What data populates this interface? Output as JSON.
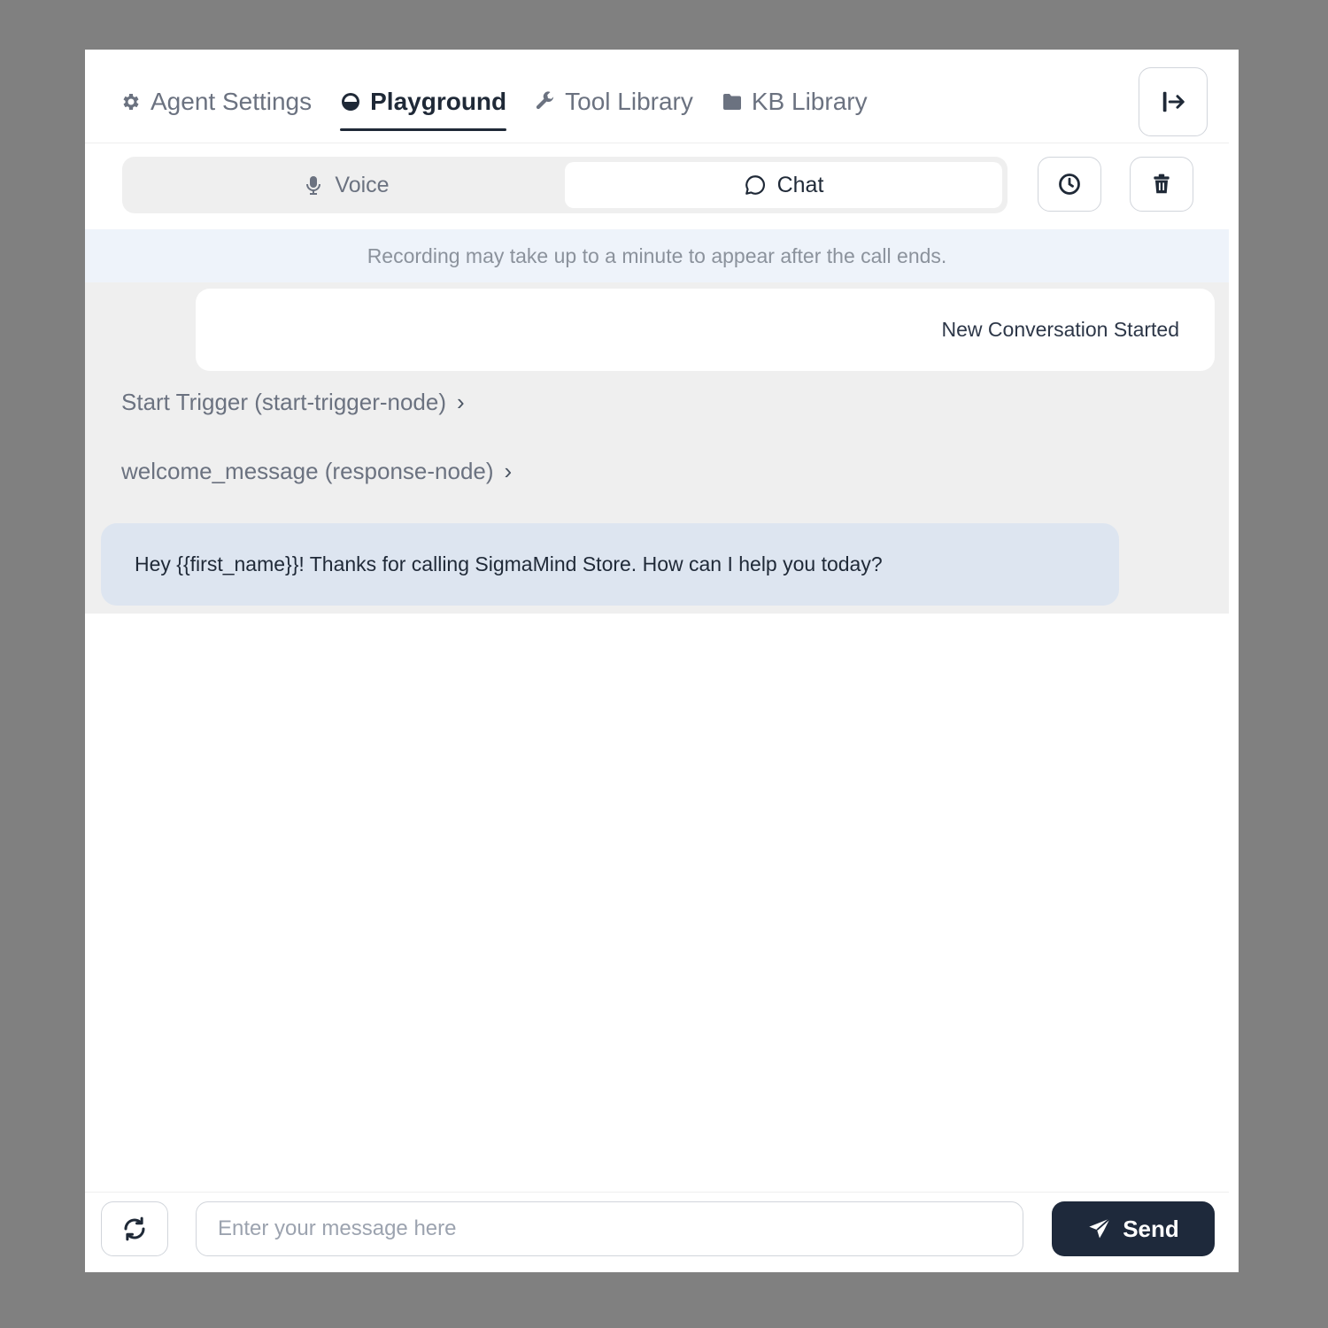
{
  "nav": {
    "tabs": [
      {
        "label": "Agent Settings",
        "icon": "gear-icon",
        "active": false
      },
      {
        "label": "Playground",
        "icon": "playground-icon",
        "active": true
      },
      {
        "label": "Tool Library",
        "icon": "wrench-icon",
        "active": false
      },
      {
        "label": "KB Library",
        "icon": "folder-icon",
        "active": false
      }
    ],
    "exit_icon": "exit-panel-icon"
  },
  "mode": {
    "options": [
      {
        "label": "Voice",
        "icon": "microphone-icon",
        "active": false
      },
      {
        "label": "Chat",
        "icon": "chat-bubble-icon",
        "active": true
      }
    ],
    "history_icon": "clock-icon",
    "delete_icon": "trash-icon"
  },
  "notice": "Recording may take up to a minute to appear after the call ends.",
  "conversation": {
    "system_message": "New Conversation Started",
    "nodes": [
      {
        "label": "Start Trigger (start-trigger-node)"
      },
      {
        "label": "welcome_message (response-node)"
      }
    ],
    "agent_message": "Hey {{first_name}}! Thanks for calling SigmaMind Store. How can I help you today?"
  },
  "composer": {
    "placeholder": "Enter your message here",
    "value": "",
    "send_label": "Send",
    "refresh_icon": "refresh-icon",
    "send_icon": "paper-plane-icon"
  },
  "colors": {
    "backdrop": "#808080",
    "panel": "#ffffff",
    "conversation_bg": "#efefef",
    "notice_bg": "#eef3fa",
    "agent_bubble": "#dde5f0",
    "primary": "#1e293b"
  }
}
